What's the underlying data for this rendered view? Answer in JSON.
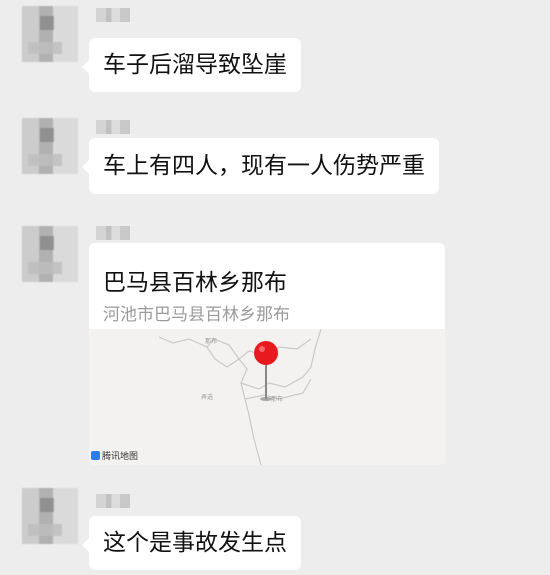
{
  "messages": [
    {
      "text": "车子后溜导致坠崖"
    },
    {
      "text": "车上有四人，现有一人伤势严重"
    },
    {
      "location": {
        "title": "巴马县百林乡那布",
        "address": "河池市巴马县百林乡那布",
        "map_provider": "腾讯地图",
        "map_labels": [
          "那布",
          "弄选",
          "那布"
        ]
      }
    },
    {
      "text": "这个是事故发生点"
    }
  ],
  "colors": {
    "background": "#ededed",
    "bubble": "#ffffff",
    "pin": "#e8191f",
    "address": "#9b9b9b"
  }
}
